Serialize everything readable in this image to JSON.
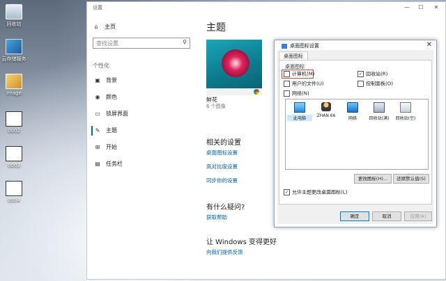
{
  "desktop": {
    "icons": [
      {
        "label": "回收站",
        "icon": "recycle-bin-icon"
      },
      {
        "label": "云存储服务",
        "icon": "app-icon"
      },
      {
        "label": "image",
        "icon": "image-folder-icon"
      },
      {
        "label": "0002",
        "icon": "document-icon"
      },
      {
        "label": "0003",
        "icon": "document-icon"
      },
      {
        "label": "0004",
        "icon": "document-icon"
      }
    ]
  },
  "settings": {
    "window_title": "设置",
    "controls": {
      "minimize": "—",
      "maximize": "☐",
      "close": "✕"
    },
    "home_label": "主页",
    "search_placeholder": "查找设置",
    "section_label": "个性化",
    "nav": [
      {
        "label": "背景",
        "icon": "picture-icon"
      },
      {
        "label": "颜色",
        "icon": "palette-icon"
      },
      {
        "label": "锁屏界面",
        "icon": "lock-screen-icon"
      },
      {
        "label": "主题",
        "icon": "brush-icon",
        "active": true
      },
      {
        "label": "开始",
        "icon": "start-icon"
      },
      {
        "label": "任务栏",
        "icon": "taskbar-icon"
      }
    ],
    "page_title": "主题",
    "theme": {
      "name": "鲜花",
      "count": "6 个图像"
    },
    "related": {
      "heading": "相关的设置",
      "links": [
        "桌面图标设置",
        "高对比度设置",
        "同步你的设置"
      ]
    },
    "questions": {
      "heading": "有什么疑问?",
      "link": "获取帮助"
    },
    "improve": {
      "heading": "让 Windows 变得更好",
      "link": "向我们提供反馈"
    }
  },
  "dialog": {
    "title": "桌面图标设置",
    "close": "✕",
    "tab": "桌面图标",
    "group_label": "桌面图标",
    "checkboxes": [
      {
        "label": "计算机(M)",
        "checked": false
      },
      {
        "label": "回收站(R)",
        "checked": true
      },
      {
        "label": "用户的文件(U)",
        "checked": false
      },
      {
        "label": "控制面板(O)",
        "checked": false
      },
      {
        "label": "网络(N)",
        "checked": false
      }
    ],
    "icons": [
      {
        "label": "此电脑",
        "icon": "this-pc-icon"
      },
      {
        "label": "ZHAN 66",
        "icon": "user-folder-icon"
      },
      {
        "label": "网络",
        "icon": "network-icon"
      },
      {
        "label": "回收站(满)",
        "icon": "recycle-bin-full-icon"
      },
      {
        "label": "回收站(空)",
        "icon": "recycle-bin-empty-icon"
      }
    ],
    "change_icon_button": "更改图标(H)...",
    "restore_default_button": "还原默认值(S)",
    "allow_themes_label": "允许主题更改桌面图标(L)",
    "allow_themes_checked": true,
    "ok_button": "确定",
    "cancel_button": "取消",
    "apply_button": "应用(A)"
  }
}
